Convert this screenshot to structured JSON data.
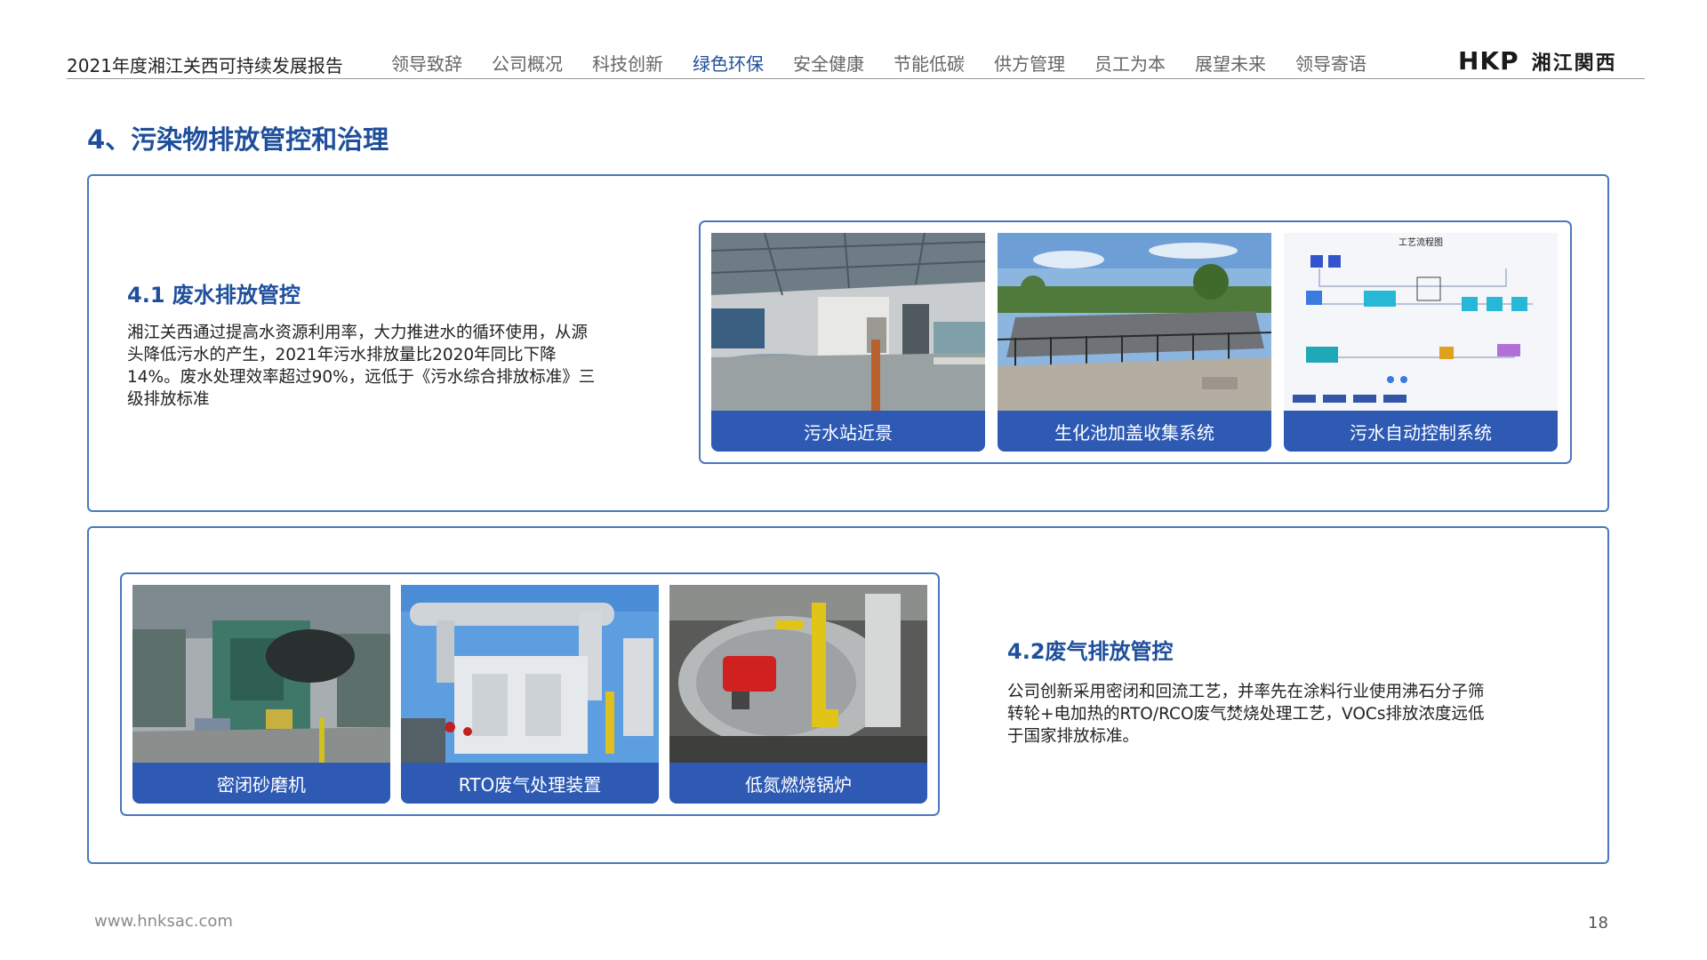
{
  "header": {
    "report_title": "2021年度湘江关西可持续发展报告",
    "nav": [
      "领导致辞",
      "公司概况",
      "科技创新",
      "绿色环保",
      "安全健康",
      "节能低碳",
      "供方管理",
      "员工为本",
      "展望未来",
      "领导寄语"
    ],
    "active_nav": "绿色环保",
    "logo_mark": "HKP",
    "logo_text": "湘江関西"
  },
  "section": {
    "title": "4、污染物排放管控和治理"
  },
  "wastewater": {
    "title": "4.1 废水排放管控",
    "body": "湘江关西通过提高水资源利用率，大力推进水的循环使用，从源头降低污水的产生，2021年污水排放量比2020年同比下降14%。废水处理效率超过90%，远低于《污水综合排放标准》三级排放标准",
    "photos": [
      {
        "caption": "污水站近景"
      },
      {
        "caption": "生化池加盖收集系统"
      },
      {
        "caption": "污水自动控制系统",
        "diagram_title": "工艺流程图"
      }
    ]
  },
  "exhaust": {
    "title": "4.2废气排放管控",
    "body": "公司创新采用密闭和回流工艺，并率先在涂料行业使用沸石分子筛转轮+电加热的RTO/RCO废气焚烧处理工艺，VOCs排放浓度远低于国家排放标准。",
    "photos": [
      {
        "caption": "密闭砂磨机"
      },
      {
        "caption": "RTO废气处理装置"
      },
      {
        "caption": "低氮燃烧锅炉"
      }
    ]
  },
  "footer": {
    "url": "www.hnksac.com",
    "page": "18"
  },
  "colors": {
    "accent": "#1f4f9c",
    "border": "#4a78bd",
    "caption_bg": "#2e5ab4"
  }
}
